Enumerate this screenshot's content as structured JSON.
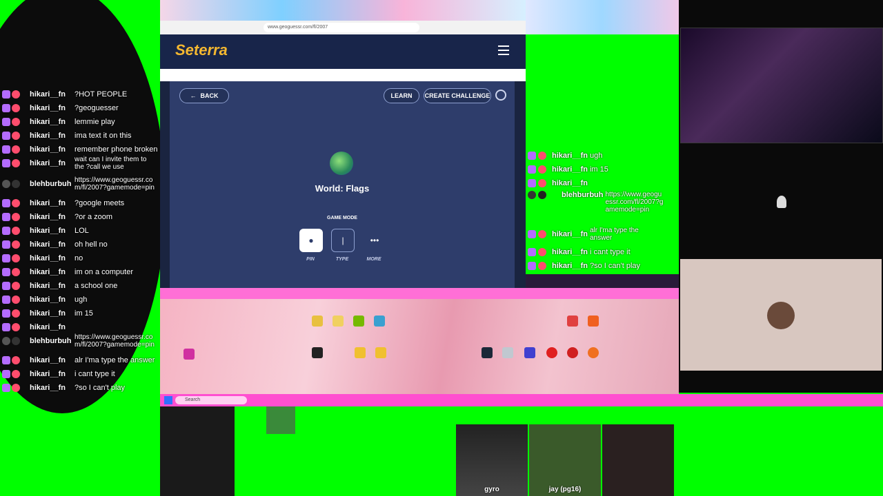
{
  "left_chat": {
    "messages": [
      {
        "user": "hikari__fn",
        "text": "?HOT PEOPLE"
      },
      {
        "user": "hikari__fn",
        "text": "?geoguesser"
      },
      {
        "user": "hikari__fn",
        "text": "lemmie play"
      },
      {
        "user": "hikari__fn",
        "text": "ima text it on this"
      },
      {
        "user": "hikari__fn",
        "text": "remember phone broken"
      },
      {
        "user": "hikari__fn",
        "text": "wait can I invite them to the ?call we use"
      },
      {
        "user": "blehburbuh",
        "text": "https://www.geoguessr.com/fl/2007?gamemode=pin"
      },
      {
        "user": "hikari__fn",
        "text": "?google meets"
      },
      {
        "user": "hikari__fn",
        "text": "?or a zoom"
      },
      {
        "user": "hikari__fn",
        "text": "LOL"
      },
      {
        "user": "hikari__fn",
        "text": "oh hell no"
      },
      {
        "user": "hikari__fn",
        "text": "no"
      },
      {
        "user": "hikari__fn",
        "text": "im on a computer"
      },
      {
        "user": "hikari__fn",
        "text": "a school one"
      },
      {
        "user": "hikari__fn",
        "text": "ugh"
      },
      {
        "user": "hikari__fn",
        "text": "im 15"
      },
      {
        "user": "hikari__fn",
        "text": ""
      },
      {
        "user": "blehburbuh",
        "text": "https://www.geoguessr.com/fl/2007?gamemode=pin"
      },
      {
        "user": "hikari__fn",
        "text": "alr I'ma type the answer"
      },
      {
        "user": "hikari__fn",
        "text": "i cant type it"
      },
      {
        "user": "hikari__fn",
        "text": "?so I can't play"
      }
    ]
  },
  "browser": {
    "url": "www.geoguessr.com/fl/2007",
    "logo": "Seterra",
    "back_label": "BACK",
    "learn_label": "LEARN",
    "create_label": "CREATE CHALLENGE",
    "quiz_title": "World: Flags",
    "game_mode_label": "GAME MODE",
    "modes": [
      {
        "label": "PIN",
        "icon": "pin-icon"
      },
      {
        "label": "TYPE",
        "icon": "cursor-icon"
      },
      {
        "label": "MORE",
        "icon": "ellipsis-icon"
      }
    ]
  },
  "mid_chat": {
    "messages": [
      {
        "user": "hikari__fn",
        "text": "ugh"
      },
      {
        "user": "hikari__fn",
        "text": "im 15"
      },
      {
        "user": "hikari__fn",
        "text": ""
      },
      {
        "user": "blehburbuh",
        "text": "https://www.geoguessr.com/fl/2007?gamemode=pin"
      },
      {
        "user": "hikari__fn",
        "text": "alr I'ma type the answer"
      },
      {
        "user": "hikari__fn",
        "text": "i cant type it"
      },
      {
        "user": "hikari__fn",
        "text": "?so I can't play"
      }
    ]
  },
  "taskbar": {
    "search_label": "Search"
  },
  "cams": {
    "cam1_name": "gyro",
    "cam2_name": "jay (pg16)"
  }
}
